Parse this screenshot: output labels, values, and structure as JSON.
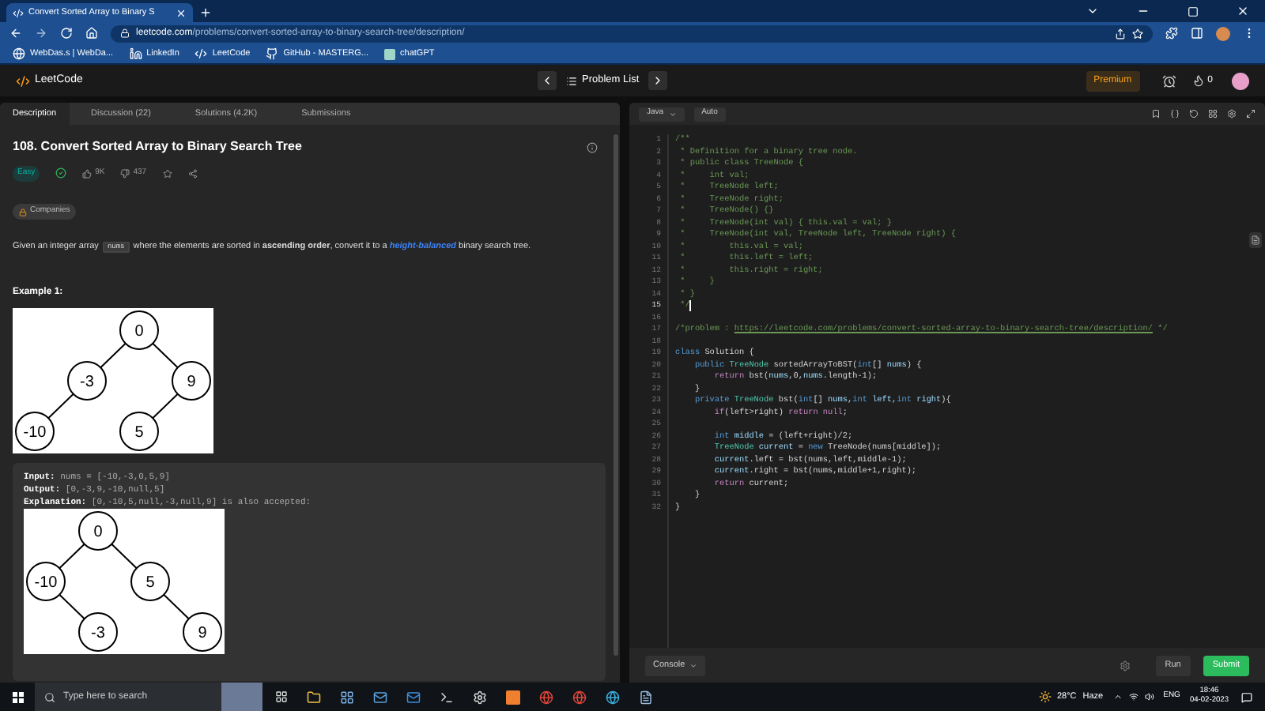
{
  "browser": {
    "tab_title": "Convert Sorted Array to Binary S",
    "url_domain": "leetcode.com",
    "url_path": "/problems/convert-sorted-array-to-binary-search-tree/description/",
    "bookmarks": [
      {
        "label": "WebDas.s | WebDa..."
      },
      {
        "label": "LinkedIn"
      },
      {
        "label": "LeetCode"
      },
      {
        "label": "GitHub - MASTERG..."
      },
      {
        "label": "chatGPT"
      }
    ]
  },
  "nav": {
    "logo_text": "LeetCode",
    "problem_list": "Problem List",
    "premium": "Premium",
    "streak_count": "0"
  },
  "tabs": [
    {
      "label": "Description",
      "selected": true
    },
    {
      "label": "Discussion (22)",
      "selected": false
    },
    {
      "label": "Solutions (4.2K)",
      "selected": false
    },
    {
      "label": "Submissions",
      "selected": false
    }
  ],
  "problem": {
    "title": "108. Convert Sorted Array to Binary Search Tree",
    "difficulty": "Easy",
    "likes": "9K",
    "dislikes": "437",
    "companies": "Companies",
    "description": [
      {
        "kind": "text",
        "text": "Given an integer array "
      },
      {
        "kind": "code",
        "text": "nums"
      },
      {
        "kind": "text",
        "text": " where the elements are sorted in **ascending order**, convert it to a "
      },
      {
        "kind": "link",
        "text": "height-balanced"
      },
      {
        "kind": "text",
        "text": " binary search tree."
      }
    ],
    "example_title": "Example 1:",
    "tree_1": {
      "value": "0",
      "left": {
        "value": "-3",
        "left": {
          "value": "-10"
        }
      },
      "right": {
        "value": "9",
        "left": {
          "value": "5"
        }
      }
    },
    "example_lines": [
      {
        "label": "Input:",
        "text": "nums = [-10,-3,0,5,9]"
      },
      {
        "label": "Output:",
        "text": "[0,-3,9,-10,null,5]"
      },
      {
        "label": "Explanation:",
        "text": "[0,-10,5,null,-3,null,9] is also accepted:"
      }
    ],
    "tree_2": {
      "value": "0",
      "left": {
        "value": "-10",
        "right": {
          "value": "-3"
        }
      },
      "right": {
        "value": "5",
        "right": {
          "value": "9"
        }
      }
    }
  },
  "editor": {
    "language": "Java",
    "mode": "Auto",
    "lines": [
      {
        "number": "1",
        "tokens": [
          {
            "text": "/**",
            "kind": "comment"
          }
        ]
      },
      {
        "number": "2",
        "tokens": [
          {
            "text": " * Definition for a binary tree node.",
            "kind": "comment"
          }
        ]
      },
      {
        "number": "3",
        "tokens": [
          {
            "text": " * public class TreeNode {",
            "kind": "comment"
          }
        ]
      },
      {
        "number": "4",
        "tokens": [
          {
            "text": " *     int val;",
            "kind": "comment"
          }
        ]
      },
      {
        "number": "5",
        "tokens": [
          {
            "text": " *     TreeNode left;",
            "kind": "comment"
          }
        ]
      },
      {
        "number": "6",
        "tokens": [
          {
            "text": " *     TreeNode right;",
            "kind": "comment"
          }
        ]
      },
      {
        "number": "7",
        "tokens": [
          {
            "text": " *     TreeNode() {}",
            "kind": "comment"
          }
        ]
      },
      {
        "number": "8",
        "tokens": [
          {
            "text": " *     TreeNode(int val) { this.val = val; }",
            "kind": "comment"
          }
        ]
      },
      {
        "number": "9",
        "tokens": [
          {
            "text": " *     TreeNode(int val, TreeNode left, TreeNode right) {",
            "kind": "comment"
          }
        ]
      },
      {
        "number": "10",
        "tokens": [
          {
            "text": " *         this.val = val;",
            "kind": "comment"
          }
        ]
      },
      {
        "number": "11",
        "tokens": [
          {
            "text": " *         this.left = left;",
            "kind": "comment"
          }
        ]
      },
      {
        "number": "12",
        "tokens": [
          {
            "text": " *         this.right = right;",
            "kind": "comment"
          }
        ]
      },
      {
        "number": "13",
        "tokens": [
          {
            "text": " *     }",
            "kind": "comment"
          }
        ]
      },
      {
        "number": "14",
        "tokens": [
          {
            "text": " * }",
            "kind": "comment"
          }
        ]
      },
      {
        "number": "15",
        "current": true,
        "tokens": [
          {
            "text": " */",
            "kind": "comment"
          }
        ]
      },
      {
        "number": "16"
      },
      {
        "number": "17",
        "tokens": [
          {
            "text": "/*problem : ",
            "kind": "comment"
          },
          {
            "text": "https://leetcode.com/problems/convert-sorted-array-to-binary-search-tree/description/",
            "kind": "link"
          },
          {
            "text": " */",
            "kind": "comment"
          }
        ]
      },
      {
        "number": "18"
      },
      {
        "number": "19",
        "tokens": [
          {
            "text": "class ",
            "kind": "keyword"
          },
          {
            "text": "Solution {",
            "kind": "plain"
          }
        ]
      },
      {
        "number": "20",
        "tokens": [
          {
            "text": "    public ",
            "kind": "keyword"
          },
          {
            "text": "TreeNode ",
            "kind": "type"
          },
          {
            "text": "sortedArrayToBST(",
            "kind": "plain"
          },
          {
            "text": "int",
            "kind": "keyword"
          },
          {
            "text": "[] ",
            "kind": "plain"
          },
          {
            "text": "nums",
            "kind": "variable"
          },
          {
            "text": ") {",
            "kind": "plain"
          }
        ]
      },
      {
        "number": "21",
        "tokens": [
          {
            "text": "        return ",
            "kind": "control"
          },
          {
            "text": "bst(",
            "kind": "plain"
          },
          {
            "text": "nums",
            "kind": "variable"
          },
          {
            "text": ",0,",
            "kind": "plain"
          },
          {
            "text": "nums",
            "kind": "variable"
          },
          {
            "text": ".length-1);",
            "kind": "plain"
          }
        ]
      },
      {
        "number": "22",
        "tokens": [
          {
            "text": "    }",
            "kind": "plain"
          }
        ]
      },
      {
        "number": "23",
        "tokens": [
          {
            "text": "    private ",
            "kind": "keyword"
          },
          {
            "text": "TreeNode ",
            "kind": "type"
          },
          {
            "text": "bst(",
            "kind": "plain"
          },
          {
            "text": "int",
            "kind": "keyword"
          },
          {
            "text": "[] ",
            "kind": "plain"
          },
          {
            "text": "nums",
            "kind": "variable"
          },
          {
            "text": ",",
            "kind": "plain"
          },
          {
            "text": "int ",
            "kind": "keyword"
          },
          {
            "text": "left",
            "kind": "variable"
          },
          {
            "text": ",",
            "kind": "plain"
          },
          {
            "text": "int ",
            "kind": "keyword"
          },
          {
            "text": "right",
            "kind": "variable"
          },
          {
            "text": "){",
            "kind": "plain"
          }
        ]
      },
      {
        "number": "24",
        "tokens": [
          {
            "text": "        if",
            "kind": "control"
          },
          {
            "text": "(left>right) ",
            "kind": "plain"
          },
          {
            "text": "return null",
            "kind": "control"
          },
          {
            "text": ";",
            "kind": "plain"
          }
        ]
      },
      {
        "number": "25"
      },
      {
        "number": "26",
        "tokens": [
          {
            "text": "        int ",
            "kind": "keyword"
          },
          {
            "text": "middle",
            "kind": "variable"
          },
          {
            "text": " = (left+right)/2;",
            "kind": "plain"
          }
        ]
      },
      {
        "number": "27",
        "tokens": [
          {
            "text": "        TreeNode ",
            "kind": "type"
          },
          {
            "text": "current",
            "kind": "variable"
          },
          {
            "text": " = ",
            "kind": "plain"
          },
          {
            "text": "new ",
            "kind": "keyword"
          },
          {
            "text": "TreeNode(nums[middle]);",
            "kind": "plain"
          }
        ]
      },
      {
        "number": "28",
        "tokens": [
          {
            "text": "        current",
            "kind": "variable"
          },
          {
            "text": ".left = bst(nums,left,middle-1);",
            "kind": "plain"
          }
        ]
      },
      {
        "number": "29",
        "tokens": [
          {
            "text": "        current",
            "kind": "variable"
          },
          {
            "text": ".right = bst(nums,middle+1,right);",
            "kind": "plain"
          }
        ]
      },
      {
        "number": "30",
        "tokens": [
          {
            "text": "        return ",
            "kind": "control"
          },
          {
            "text": "current;",
            "kind": "plain"
          }
        ]
      },
      {
        "number": "31",
        "tokens": [
          {
            "text": "    }",
            "kind": "plain"
          }
        ]
      },
      {
        "number": "32",
        "tokens": [
          {
            "text": "}",
            "kind": "plain"
          }
        ]
      }
    ]
  },
  "console": {
    "label": "Console"
  },
  "actions": {
    "run": "Run",
    "submit": "Submit"
  },
  "taskbar": {
    "search_placeholder": "Type here to search",
    "weather": "28°C",
    "condition": "Haze",
    "language": "ENG",
    "time": "18:46",
    "date": "04-02-2023"
  }
}
